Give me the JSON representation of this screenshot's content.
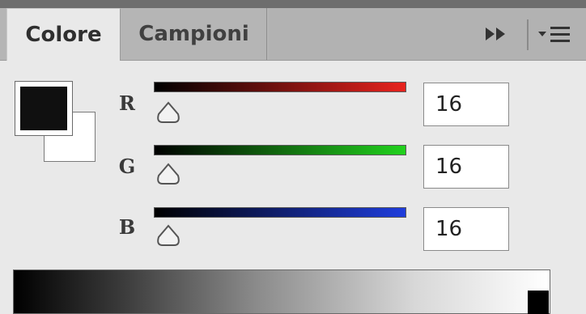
{
  "tabs": [
    {
      "label": "Colore",
      "active": true
    },
    {
      "label": "Campioni",
      "active": false
    }
  ],
  "icons": {
    "expand": "double-chevron-right-icon",
    "menu": "panel-menu-icon"
  },
  "swatches": {
    "foreground_color": "#101010",
    "background_color": "#ffffff"
  },
  "channels": [
    {
      "label": "R",
      "value": "16",
      "color": "#e8231e"
    },
    {
      "label": "G",
      "value": "16",
      "color": "#22d21e"
    },
    {
      "label": "B",
      "value": "16",
      "color": "#1f3ddc"
    }
  ]
}
